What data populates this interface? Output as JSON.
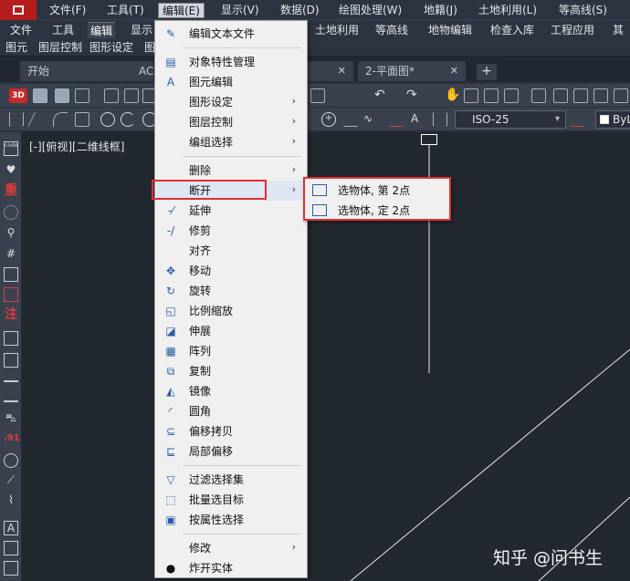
{
  "menubar": {
    "items": [
      "文件(F)",
      "工具(T)",
      "编辑(E)",
      "显示(V)",
      "数据(D)",
      "绘图处理(W)",
      "地籍(J)",
      "土地利用(L)",
      "等高线(S)"
    ]
  },
  "ribbon": {
    "tabs": [
      "文件",
      "工具",
      "编辑",
      "显示",
      "土地利用",
      "等高线",
      "地物编辑",
      "检查入库",
      "工程应用",
      "其他"
    ]
  },
  "panels": [
    "图元",
    "图层控制",
    "图形设定",
    "图"
  ],
  "doctabs": {
    "tabs": [
      "开始",
      "AC",
      "2-平面图*"
    ],
    "close_glyph": "✕",
    "plus_glyph": "+"
  },
  "toolbar2": {
    "dimstyle": "ISO-25",
    "layer": "ByL"
  },
  "canvas": {
    "view_label": "[-][俯视][二维线框]",
    "watermark": "知乎 @问书生"
  },
  "edit_menu": {
    "items": [
      {
        "label": "编辑文本文件",
        "icon": "edit-text-icon"
      },
      {
        "label": "对象特性管理",
        "icon": "properties-icon"
      },
      {
        "label": "图元编辑",
        "icon": "entity-edit-icon"
      },
      {
        "label": "图形设定",
        "submenu": true
      },
      {
        "label": "图层控制",
        "submenu": true
      },
      {
        "label": "编组选择",
        "submenu": true
      },
      {
        "label": "删除",
        "submenu": true
      },
      {
        "label": "断开",
        "submenu": true,
        "highlighted": true
      },
      {
        "label": "延伸",
        "icon": "extend-icon"
      },
      {
        "label": "修剪",
        "icon": "trim-icon"
      },
      {
        "label": "对齐"
      },
      {
        "label": "移动",
        "icon": "move-icon"
      },
      {
        "label": "旋转",
        "icon": "rotate-icon"
      },
      {
        "label": "比例缩放",
        "icon": "scale-icon"
      },
      {
        "label": "伸展",
        "icon": "stretch-icon"
      },
      {
        "label": "阵列",
        "icon": "array-icon"
      },
      {
        "label": "复制",
        "icon": "copy-icon"
      },
      {
        "label": "镜像",
        "icon": "mirror-icon"
      },
      {
        "label": "圆角",
        "icon": "fillet-icon"
      },
      {
        "label": "偏移拷贝",
        "icon": "offset-icon"
      },
      {
        "label": "局部偏移",
        "icon": "local-offset-icon"
      },
      {
        "label": "过滤选择集",
        "icon": "filter-icon"
      },
      {
        "label": "批量选目标",
        "icon": "batch-select-icon"
      },
      {
        "label": "按属性选择",
        "icon": "select-by-attr-icon"
      },
      {
        "label": "修改",
        "submenu": true
      },
      {
        "label": "炸开实体",
        "icon": "explode-icon"
      }
    ],
    "submenu_arrow": "›"
  },
  "break_submenu": {
    "items": [
      "选物体, 第 2点",
      "选物体, 定 2点"
    ]
  },
  "colors": {
    "highlight_box": "#e03030",
    "canvas_bg": "#212830",
    "menu_bg": "#f0f0f0"
  }
}
